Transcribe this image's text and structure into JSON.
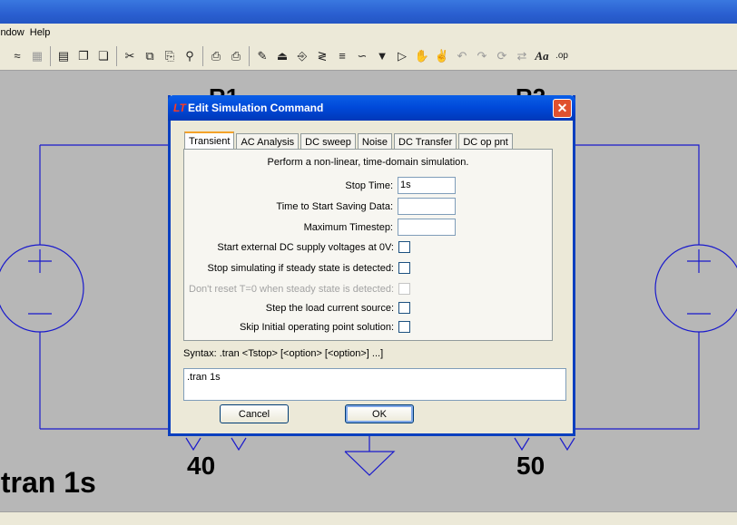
{
  "menubar": {
    "items": [
      "indow",
      "Help"
    ]
  },
  "toolbar": {
    "icons": [
      "graph-icon",
      "graph-dim-icon",
      "tile-h-icon",
      "cascade-icon",
      "windows-icon",
      "cut-icon",
      "copy-icon",
      "paste-icon",
      "find-icon",
      "print-setup-icon",
      "print-icon",
      "pencil-icon",
      "ground-icon",
      "label-icon",
      "resistor-icon",
      "capacitor-icon",
      "inductor-icon",
      "diode-icon",
      "component-icon",
      "hand-move-icon",
      "hand-drag-icon",
      "undo-icon",
      "redo-icon",
      "rotate-icon",
      "mirror-icon",
      "text-icon",
      "spice-directive-icon"
    ]
  },
  "canvas": {
    "labels": {
      "r1_partial": "R1",
      "r2_partial": "R2",
      "net_left": "40",
      "net_right": "50",
      "directive": ".tran 1s"
    },
    "wire_color": "#1a1acc"
  },
  "dialog": {
    "title": "Edit Simulation Command",
    "close_glyph": "✕",
    "tabs": [
      "Transient",
      "AC Analysis",
      "DC sweep",
      "Noise",
      "DC Transfer",
      "DC op pnt"
    ],
    "active_tab": "Transient",
    "description": "Perform a non-linear, time-domain simulation.",
    "fields": {
      "stop_time": {
        "label": "Stop Time:",
        "value": "1s"
      },
      "start_saving": {
        "label": "Time to Start Saving Data:",
        "value": ""
      },
      "max_timestep": {
        "label": "Maximum Timestep:",
        "value": ""
      }
    },
    "options": {
      "start_dc_zero": {
        "label": "Start external DC supply voltages at 0V:",
        "checked": false
      },
      "steady_state": {
        "label": "Stop simulating if steady state is detected:",
        "checked": false
      },
      "no_reset_t0": {
        "label": "Don't reset T=0 when steady state is detected:",
        "checked": false,
        "disabled": true
      },
      "step_load": {
        "label": "Step the load current source:",
        "checked": false
      },
      "skip_initial": {
        "label": "Skip Initial operating point solution:",
        "checked": false
      }
    },
    "syntax": "Syntax:  .tran <Tstop> [<option> [<option>] ...]",
    "command": ".tran 1s",
    "cancel_label": "Cancel",
    "ok_label": "OK"
  }
}
